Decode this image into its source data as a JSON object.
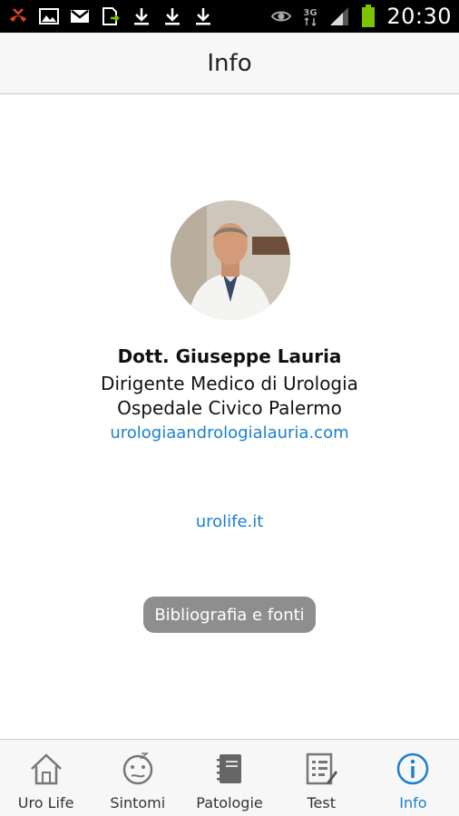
{
  "status_bar": {
    "time": "20:30",
    "network": "3G",
    "icons": [
      "missed-call-icon",
      "image-icon",
      "gmail-icon",
      "file-transfer-icon",
      "download-icon",
      "download-icon",
      "download-icon",
      "eye-icon",
      "3g-icon",
      "signal-icon",
      "battery-icon"
    ]
  },
  "header": {
    "title": "Info"
  },
  "profile": {
    "name": "Dott. Giuseppe Lauria",
    "role": "Dirigente Medico di Urologia",
    "hospital": "Ospedale Civico Palermo",
    "website": "urologiaandrologialauria.com"
  },
  "app_link": "urolife.it",
  "bibliography_button": "Bibliografia e fonti",
  "tabs": [
    {
      "label": "Uro Life",
      "icon": "home-icon",
      "active": false
    },
    {
      "label": "Sintomi",
      "icon": "confused-face-icon",
      "active": false
    },
    {
      "label": "Patologie",
      "icon": "notebook-icon",
      "active": false
    },
    {
      "label": "Test",
      "icon": "checklist-icon",
      "active": false
    },
    {
      "label": "Info",
      "icon": "info-icon",
      "active": true
    }
  ],
  "colors": {
    "accent": "#1a7fd1",
    "button_bg": "#8e8e8e",
    "bar_bg": "#f7f7f7",
    "status_bar_bg": "#000000",
    "battery": "#7dc400"
  }
}
